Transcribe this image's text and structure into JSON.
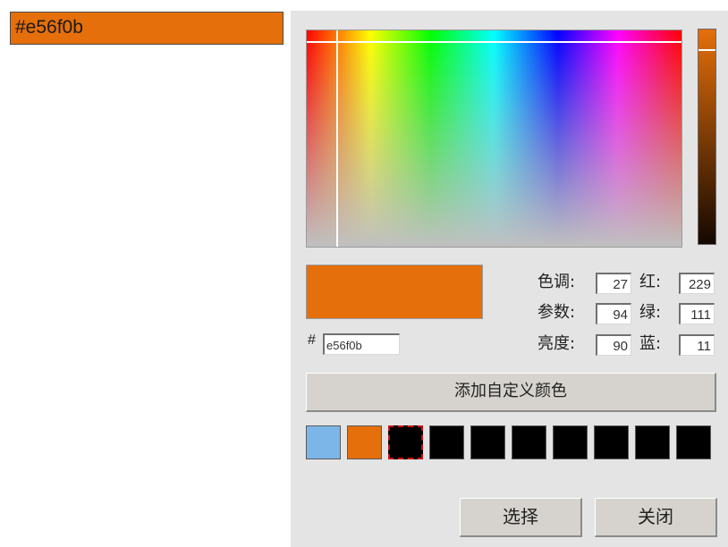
{
  "color_field": {
    "value": "#e56f0b",
    "background": "#e56f0b"
  },
  "picker": {
    "selected_color": "#e56f0b",
    "hex_prefix": "#",
    "hex_value": "e56f0b",
    "hsb": [
      {
        "label": "色调:",
        "value": "27"
      },
      {
        "label": "参数:",
        "value": "94"
      },
      {
        "label": "亮度:",
        "value": "90"
      }
    ],
    "rgb": [
      {
        "label": "红:",
        "value": "229"
      },
      {
        "label": "绿:",
        "value": "111"
      },
      {
        "label": "蓝:",
        "value": "11"
      }
    ],
    "add_custom_label": "添加自定义颜色",
    "swatches": [
      "#7cb6e8",
      "#e56f0b",
      "#000000",
      "#000000",
      "#000000",
      "#000000",
      "#000000",
      "#000000",
      "#000000",
      "#000000"
    ],
    "selected_swatch_index": 2,
    "select_label": "选择",
    "close_label": "关闭"
  }
}
